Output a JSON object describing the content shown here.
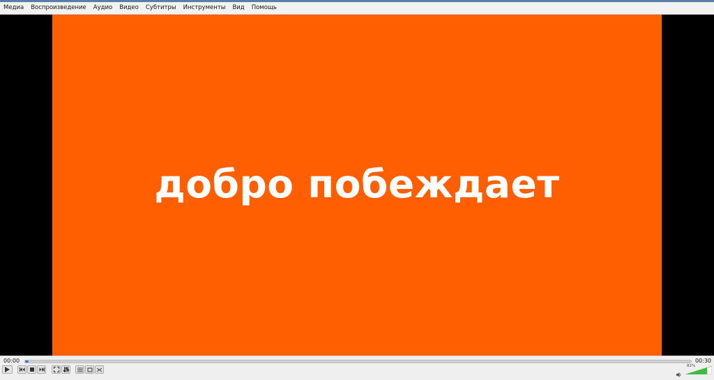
{
  "window": {
    "accent": "#5a7fa6"
  },
  "menu": {
    "items": [
      {
        "label": "Медиа"
      },
      {
        "label": "Воспроизведение"
      },
      {
        "label": "Аудио"
      },
      {
        "label": "Видео"
      },
      {
        "label": "Субтитры"
      },
      {
        "label": "Инструменты"
      },
      {
        "label": "Вид"
      },
      {
        "label": "Помощь"
      }
    ]
  },
  "video": {
    "caption": "добро побеждает",
    "background_color": "#ff5f00",
    "text_color": "#ffffff"
  },
  "controls": {
    "time_elapsed": "00:00",
    "time_total": "00:30",
    "progress": 0.005,
    "volume_label": "82%",
    "volume_level": 0.82,
    "buttons": [
      "play-icon",
      "previous-icon",
      "stop-icon",
      "next-icon",
      "fullscreen-icon",
      "extended-settings-icon",
      "playlist-icon",
      "loop-icon",
      "shuffle-icon",
      "volume-icon"
    ]
  }
}
